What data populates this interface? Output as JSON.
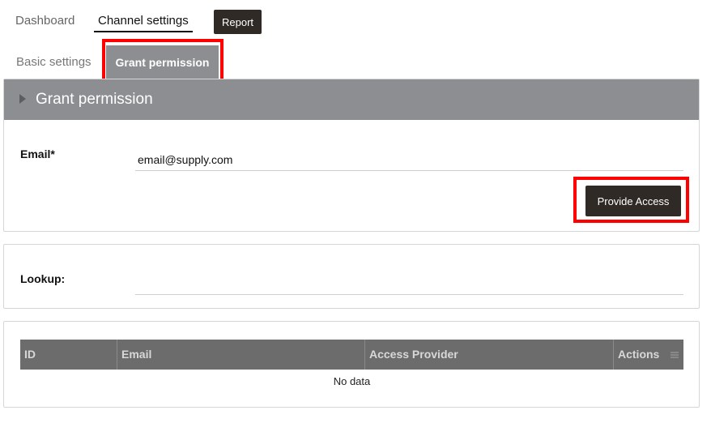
{
  "nav": {
    "dashboard": "Dashboard",
    "channel_settings": "Channel settings",
    "report": "Report"
  },
  "tabs": {
    "basic": "Basic settings",
    "grant": "Grant permission"
  },
  "grant_panel": {
    "title": "Grant permission",
    "email_label": "Email*",
    "email_value": "email@supply.com",
    "provide_button": "Provide Access"
  },
  "lookup_panel": {
    "label": "Lookup:",
    "value": ""
  },
  "table": {
    "columns": [
      "ID",
      "Email",
      "Access Provider",
      "Actions"
    ],
    "empty_text": "No data"
  },
  "icons": [
    "caret-right-icon",
    "column-menu-icon"
  ],
  "colors": {
    "header_gray": "#8c8e91",
    "dark_button": "#2f2a25",
    "table_head": "#6c6c6c",
    "highlight": "#ff0000"
  }
}
